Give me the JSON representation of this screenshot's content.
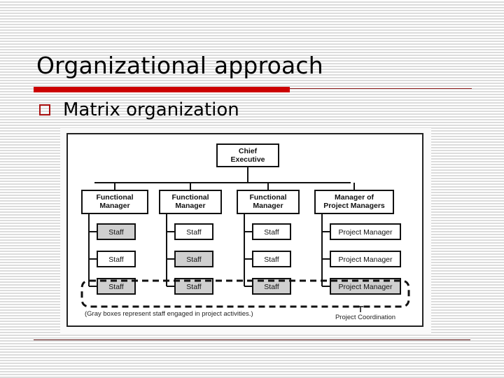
{
  "slide": {
    "title": "Organizational approach",
    "bullet": "Matrix organization"
  },
  "diagram": {
    "top": {
      "label_lines": [
        "Chief",
        "Executive"
      ],
      "gray": false
    },
    "managers": [
      {
        "label_lines": [
          "Functional",
          "Manager"
        ]
      },
      {
        "label_lines": [
          "Functional",
          "Manager"
        ]
      },
      {
        "label_lines": [
          "Functional",
          "Manager"
        ]
      },
      {
        "label_lines": [
          "Manager of",
          "Project Managers"
        ]
      }
    ],
    "columns": [
      {
        "items": [
          {
            "label": "Staff",
            "gray": true
          },
          {
            "label": "Staff",
            "gray": false
          },
          {
            "label": "Staff",
            "gray": true
          }
        ]
      },
      {
        "items": [
          {
            "label": "Staff",
            "gray": false
          },
          {
            "label": "Staff",
            "gray": true
          },
          {
            "label": "Staff",
            "gray": true
          }
        ]
      },
      {
        "items": [
          {
            "label": "Staff",
            "gray": false
          },
          {
            "label": "Staff",
            "gray": false
          },
          {
            "label": "Staff",
            "gray": true
          }
        ]
      },
      {
        "items": [
          {
            "label": "Project Manager",
            "gray": false
          },
          {
            "label": "Project Manager",
            "gray": false
          },
          {
            "label": "Project Manager",
            "gray": true
          }
        ]
      }
    ],
    "legend_note": "(Gray boxes represent staff engaged in project activities.)",
    "coordination_label": "Project Coordination",
    "colors": {
      "gray_box": "#cfcfcf",
      "accent_red": "#cc0000"
    }
  }
}
